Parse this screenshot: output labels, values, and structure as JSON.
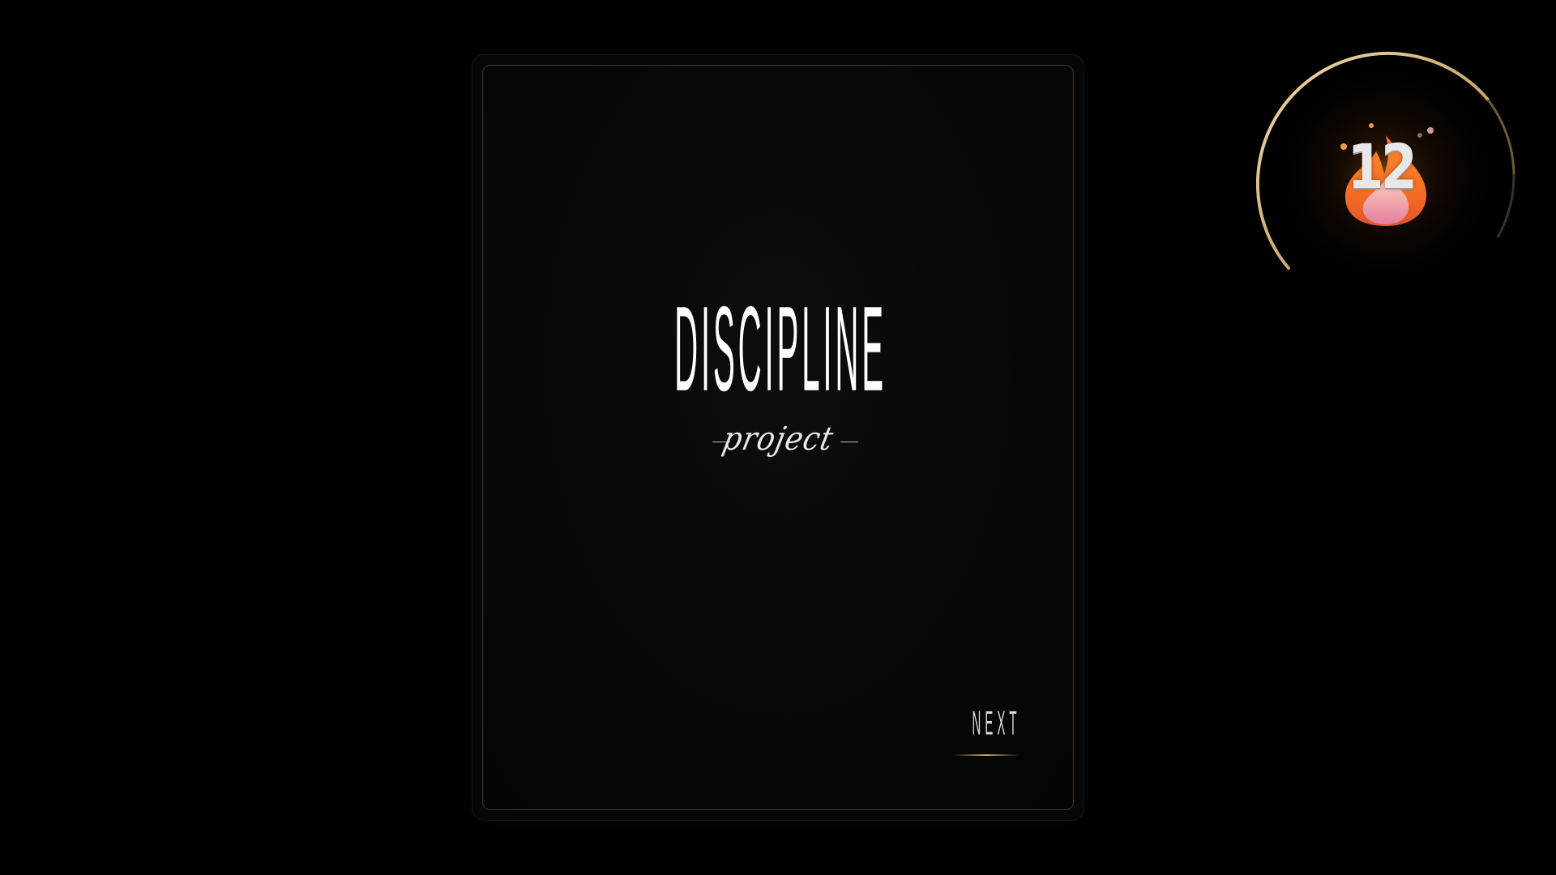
{
  "card": {
    "title": "DISCIPLINE",
    "subtitle": "project",
    "next_label": "NEXT"
  },
  "streak": {
    "count": "12",
    "icon": "flame-icon"
  },
  "colors": {
    "background": "#000000",
    "accent_gold": "#c9a866",
    "flame_orange": "#f47a2a",
    "flame_pink": "#e889a6",
    "text": "#ffffff"
  }
}
